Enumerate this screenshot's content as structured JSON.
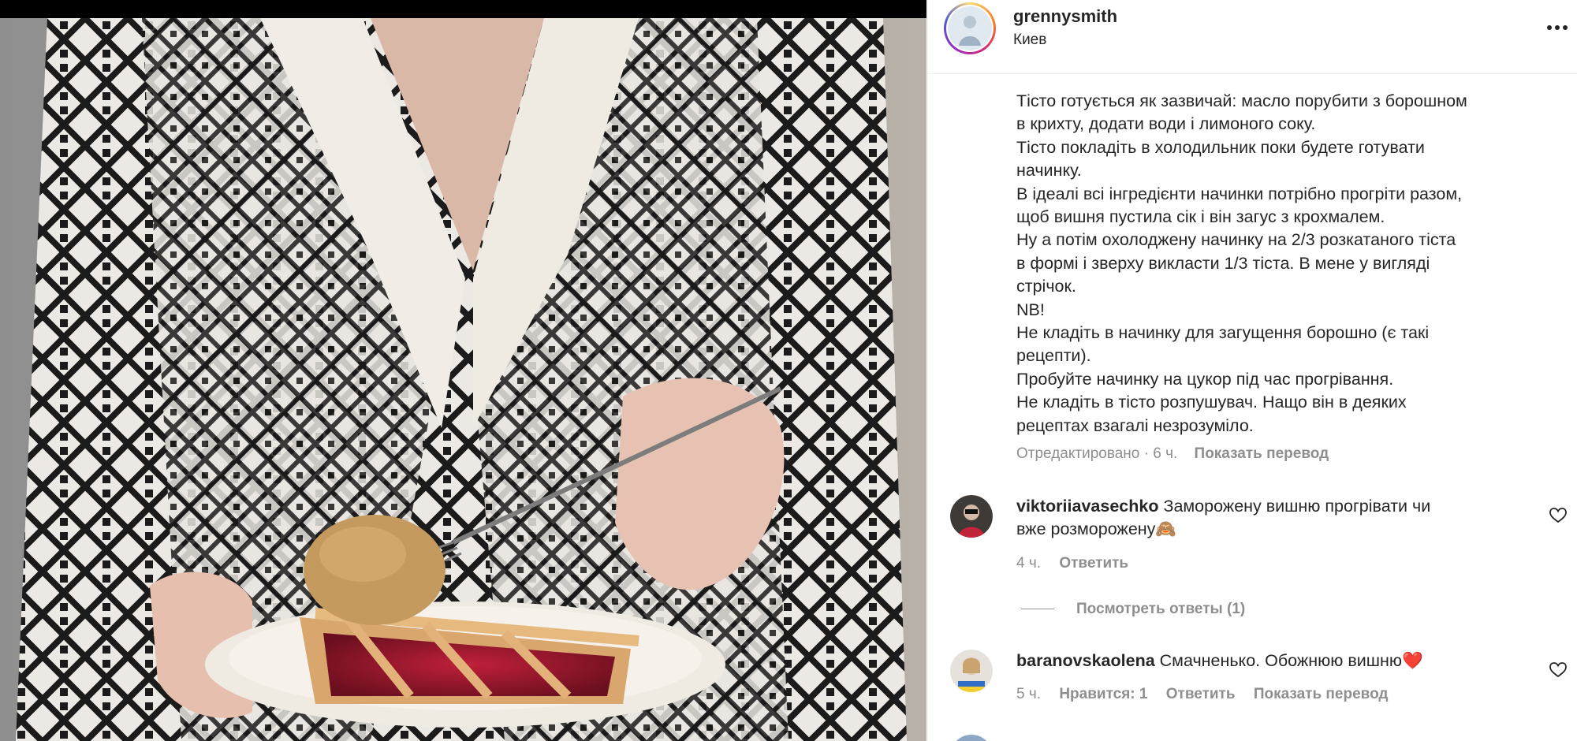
{
  "post": {
    "username": "grennysmith",
    "location": "Киев",
    "caption_lines": [
      "Тісто готується як зазвичай: масло порубити з борошном",
      "в крихту, додати води і лимоного соку.",
      "Тісто покладіть в холодильник поки будете готувати",
      "начинку.",
      "В ідеалі всі інгредієнти начинки потрібно прогріти разом,",
      "щоб вишня пустила сік і він загус з крохмалем.",
      "Ну а потім охолоджену начинку на 2/3 розкатаного тіста",
      "в формі і зверху викласти 1/3 тіста. В мене у вигляді",
      "стрічок.",
      "NB!",
      "Не кладіть в начинку для загущення борошно (є такі",
      "рецепти).",
      "Пробуйте начинку на цукор під час прогрівання.",
      "Не кладіть в тісто розпушувач. Нащо він в деяких",
      "рецептах взагалі незрозуміло."
    ],
    "edited_label": "Отредактировано · 6 ч.",
    "translate_label": "Показать перевод"
  },
  "comments": [
    {
      "username": "viktoriiavasechko",
      "text_line1": "Заморожену вишню прогрівати чи",
      "text_line2": "вже розморожену🙈",
      "time": "4 ч.",
      "reply_label": "Ответить",
      "view_replies": "Посмотреть ответы (1)"
    },
    {
      "username": "baranovskaolena",
      "text": "Смачненько. Обожнюю вишню❤️",
      "time": "5 ч.",
      "likes_label": "Нравится: 1",
      "reply_label": "Ответить",
      "translate_label": "Показать перевод"
    }
  ],
  "icons": {
    "more": "more-options-icon",
    "like": "heart-outline-icon"
  },
  "colors": {
    "text": "#262626",
    "secondary": "#8e8e8e",
    "divider": "#efefef",
    "story_ring": [
      "#feda75",
      "#fa7e1e",
      "#d62976",
      "#962fbf",
      "#4f5bd5"
    ]
  }
}
